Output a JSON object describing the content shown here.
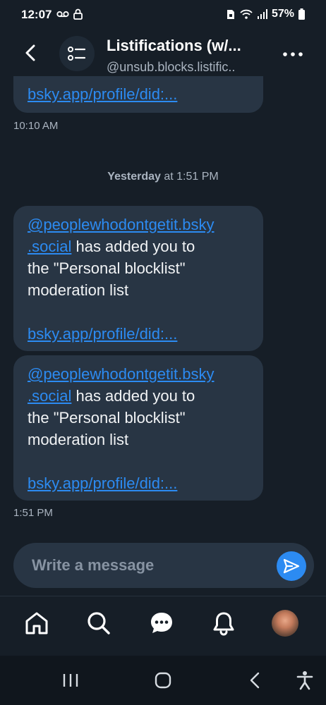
{
  "status_bar": {
    "time": "12:07",
    "battery": "57%"
  },
  "header": {
    "title": "Listifications (w/...",
    "subtitle": "@unsub.blocks.listific.."
  },
  "messages": {
    "top_partial": {
      "link": "bsky.app/profile/did:..."
    },
    "top_time": "10:10 AM",
    "day_divider": {
      "day": "Yesterday",
      "rest": " at 1:51 PM"
    },
    "items": [
      {
        "mention_line1": "@peoplewhodontgetit.bsky",
        "mention_line2": ".social",
        "text_after_mention": " has added you to",
        "line3": "the \"Personal blocklist\"",
        "line4": "moderation list",
        "link": "bsky.app/profile/did:..."
      },
      {
        "mention_line1": "@peoplewhodontgetit.bsky",
        "mention_line2": ".social",
        "text_after_mention": " has added you to",
        "line3": "the \"Personal blocklist\"",
        "line4": "moderation list",
        "link": "bsky.app/profile/did:..."
      }
    ],
    "bottom_time": "1:51 PM"
  },
  "composer": {
    "placeholder": "Write a message"
  },
  "colors": {
    "background": "#161e27",
    "bubble": "#283544",
    "accent": "#2c8bf2",
    "muted_text": "#aab4c0"
  },
  "icons": {
    "back": "chevron-left-icon",
    "list": "list-icon",
    "more": "more-horizontal-icon",
    "send": "send-icon",
    "home": "home-icon",
    "search": "search-icon",
    "chat": "chat-bubble-icon",
    "notifications": "bell-icon",
    "profile": "avatar",
    "android_recents": "recents-icon",
    "android_home": "home-square-icon",
    "android_back": "android-back-icon",
    "accessibility": "accessibility-icon"
  }
}
